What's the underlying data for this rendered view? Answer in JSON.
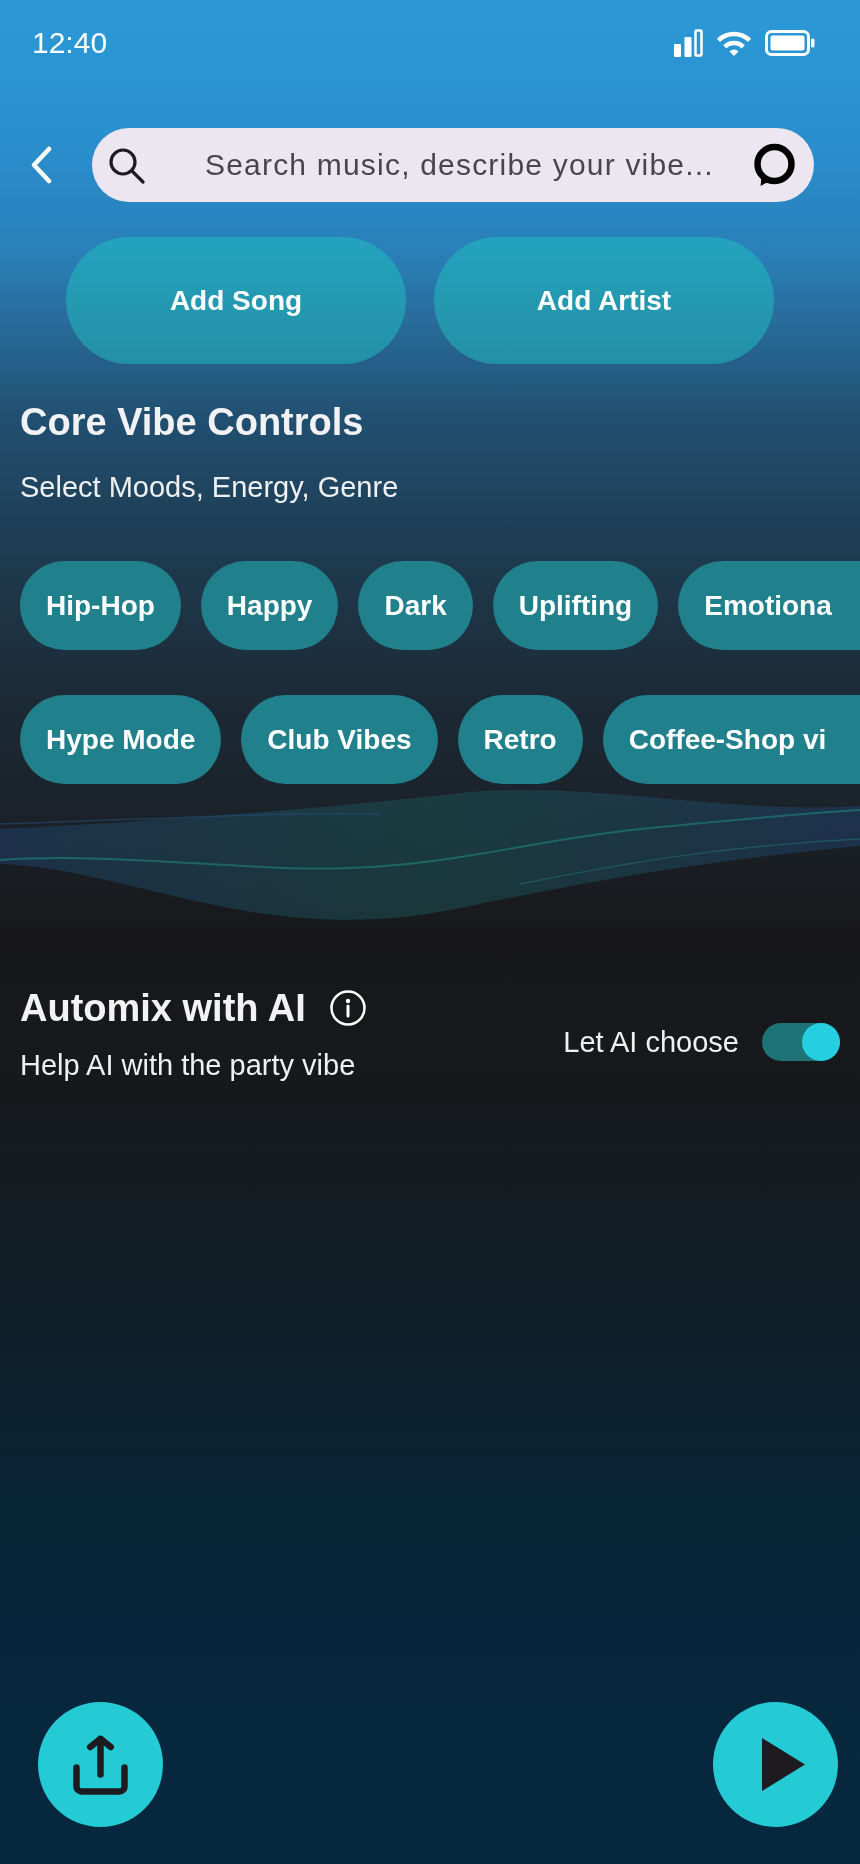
{
  "status_bar": {
    "time": "12:40"
  },
  "search": {
    "placeholder": "Search music, describe your vibe..."
  },
  "actions": [
    {
      "label": "Add Song"
    },
    {
      "label": "Add Artist"
    }
  ],
  "core_vibe_controls": {
    "title": "Core Vibe Controls",
    "subtitle": "Select Moods, Energy, Genre",
    "chip_rows": [
      {
        "chips": [
          {
            "label": "Hip-Hop"
          },
          {
            "label": "Happy"
          },
          {
            "label": "Dark"
          },
          {
            "label": "Uplifting"
          },
          {
            "label": "Emotiona"
          }
        ]
      },
      {
        "chips": [
          {
            "label": "Hype Mode"
          },
          {
            "label": "Club Vibes"
          },
          {
            "label": "Retro"
          },
          {
            "label": "Coffee-Shop vi"
          }
        ]
      }
    ]
  },
  "automix": {
    "title": "Automix with AI",
    "subtitle": "Help AI with the party vibe",
    "toggle": {
      "label": "Let AI choose",
      "on": true
    }
  }
}
